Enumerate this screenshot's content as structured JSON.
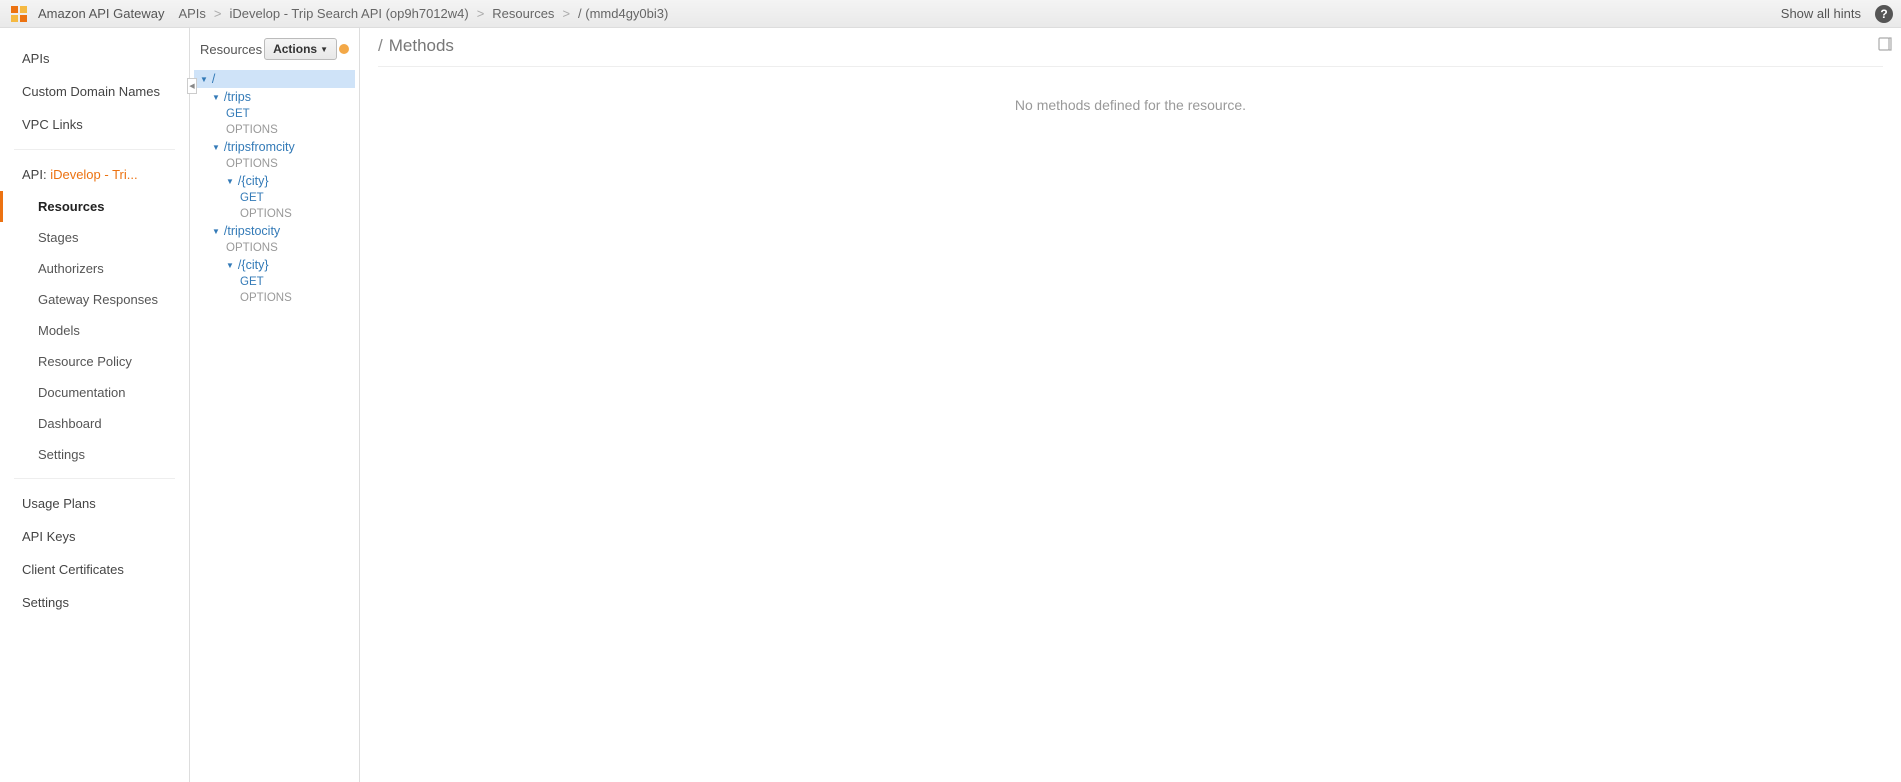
{
  "topbar": {
    "service_name": "Amazon API Gateway",
    "crumbs": [
      "APIs",
      "iDevelop - Trip Search API (op9h7012w4)",
      "Resources",
      "/ (mmd4gy0bi3)"
    ],
    "hints": "Show all hints"
  },
  "sidebar": {
    "primary": [
      "APIs",
      "Custom Domain Names",
      "VPC Links"
    ],
    "api_prefix": "API: ",
    "api_name": "iDevelop - Tri...",
    "api_items": [
      "Resources",
      "Stages",
      "Authorizers",
      "Gateway Responses",
      "Models",
      "Resource Policy",
      "Documentation",
      "Dashboard",
      "Settings"
    ],
    "active_api_item": "Resources",
    "secondary": [
      "Usage Plans",
      "API Keys",
      "Client Certificates",
      "Settings"
    ]
  },
  "resources": {
    "title": "Resources",
    "actions_label": "Actions",
    "tree": {
      "root": "/",
      "children": [
        {
          "path": "/trips",
          "methods": [
            "GET",
            "OPTIONS"
          ]
        },
        {
          "path": "/tripsfromcity",
          "methods": [
            "OPTIONS"
          ],
          "children": [
            {
              "path": "/{city}",
              "methods": [
                "GET",
                "OPTIONS"
              ]
            }
          ]
        },
        {
          "path": "/tripstocity",
          "methods": [
            "OPTIONS"
          ],
          "children": [
            {
              "path": "/{city}",
              "methods": [
                "GET",
                "OPTIONS"
              ]
            }
          ]
        }
      ]
    }
  },
  "content": {
    "path": "/",
    "title": "Methods",
    "empty": "No methods defined for the resource."
  }
}
